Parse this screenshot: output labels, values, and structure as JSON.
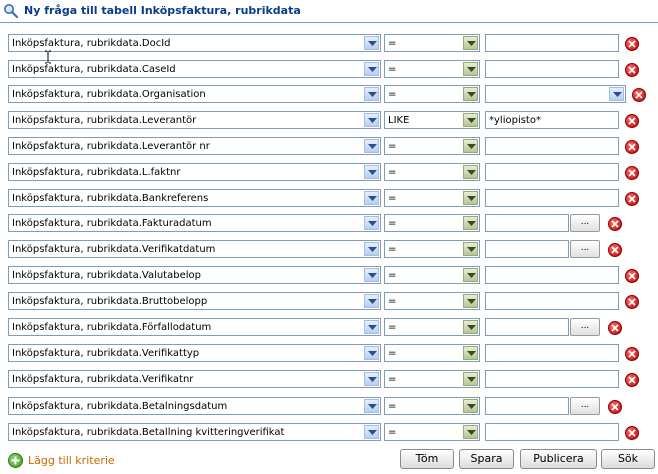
{
  "title": "Ny fråga till tabell Inköpsfaktura, rubrikdata",
  "rows": [
    {
      "field": "Inköpsfaktura, rubrikdata.DocId",
      "operator": "=",
      "value": ""
    },
    {
      "field": "Inköpsfaktura, rubrikdata.CaseId",
      "operator": "=",
      "value": ""
    },
    {
      "field": "Inköpsfaktura, rubrikdata.Organisation",
      "operator": "=",
      "value": ""
    },
    {
      "field": "Inköpsfaktura, rubrikdata.Leverantör",
      "operator": "LIKE",
      "value": "*yliopisto*"
    },
    {
      "field": "Inköpsfaktura, rubrikdata.Leverantör nr",
      "operator": "=",
      "value": ""
    },
    {
      "field": "Inköpsfaktura, rubrikdata.L.faktnr",
      "operator": "=",
      "value": ""
    },
    {
      "field": "Inköpsfaktura, rubrikdata.Bankreferens",
      "operator": "=",
      "value": ""
    },
    {
      "field": "Inköpsfaktura, rubrikdata.Fakturadatum",
      "operator": "=",
      "value": ""
    },
    {
      "field": "Inköpsfaktura, rubrikdata.Verifikatdatum",
      "operator": "=",
      "value": ""
    },
    {
      "field": "Inköpsfaktura, rubrikdata.Valutabelop",
      "operator": "=",
      "value": ""
    },
    {
      "field": "Inköpsfaktura, rubrikdata.Bruttobelopp",
      "operator": "=",
      "value": ""
    },
    {
      "field": "Inköpsfaktura, rubrikdata.Förfallodatum",
      "operator": "=",
      "value": ""
    },
    {
      "field": "Inköpsfaktura, rubrikdata.Verifikattyp",
      "operator": "=",
      "value": ""
    },
    {
      "field": "Inköpsfaktura, rubrikdata.Verifikatnr",
      "operator": "=",
      "value": ""
    },
    {
      "field": "Inköpsfaktura, rubrikdata.Betalningsdatum",
      "operator": "=",
      "value": ""
    },
    {
      "field": "Inköpsfaktura, rubrikdata.Betallning kvitteringverifikat",
      "operator": "=",
      "value": ""
    }
  ],
  "date_picker_label": "...",
  "add_criteria_label": "Lägg till kriterie",
  "buttons": {
    "clear": "Töm",
    "save": "Spara",
    "publish": "Publicera",
    "search": "Sök"
  },
  "icons": {
    "title": "magnifier-icon",
    "delete": "delete-icon",
    "add": "add-icon",
    "dropdown": "chevron-down-icon"
  },
  "colors": {
    "title_text": "#0a3c8a",
    "add_label": "#cc6600",
    "delete": "#c40000",
    "add": "#3c9a1e"
  }
}
